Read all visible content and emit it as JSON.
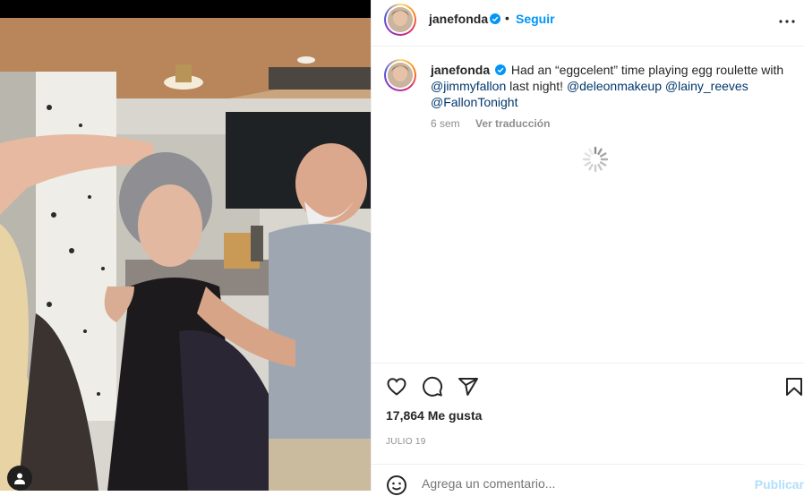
{
  "post": {
    "username": "janefonda",
    "follow_label": "Seguir",
    "separator": "•",
    "caption_username": "janefonda",
    "caption_text_1": "Had an “eggcelent” time playing egg roulette with",
    "mention_1": "@jimmyfallon",
    "caption_text_2": " last night! ",
    "mention_2": "@deleonmakeup",
    "mention_3": "@lainy_reeves",
    "mention_4": "@FallonTonight",
    "time_ago": "6 sem",
    "translate_label": "Ver traducción",
    "likes": "17,864 Me gusta",
    "date": "JULIO 19",
    "comment_placeholder": "Agrega un comentario...",
    "publish_label": "Publicar"
  },
  "colors": {
    "link_blue": "#0095f6",
    "mention": "#00376b",
    "muted": "#8e8e8e",
    "publish_disabled": "#b2dffc"
  },
  "icons": [
    "user-tag-icon",
    "verified-badge-icon",
    "more-options-icon",
    "loading-spinner-icon",
    "heart-icon",
    "comment-icon",
    "share-icon",
    "bookmark-icon",
    "emoji-icon"
  ]
}
